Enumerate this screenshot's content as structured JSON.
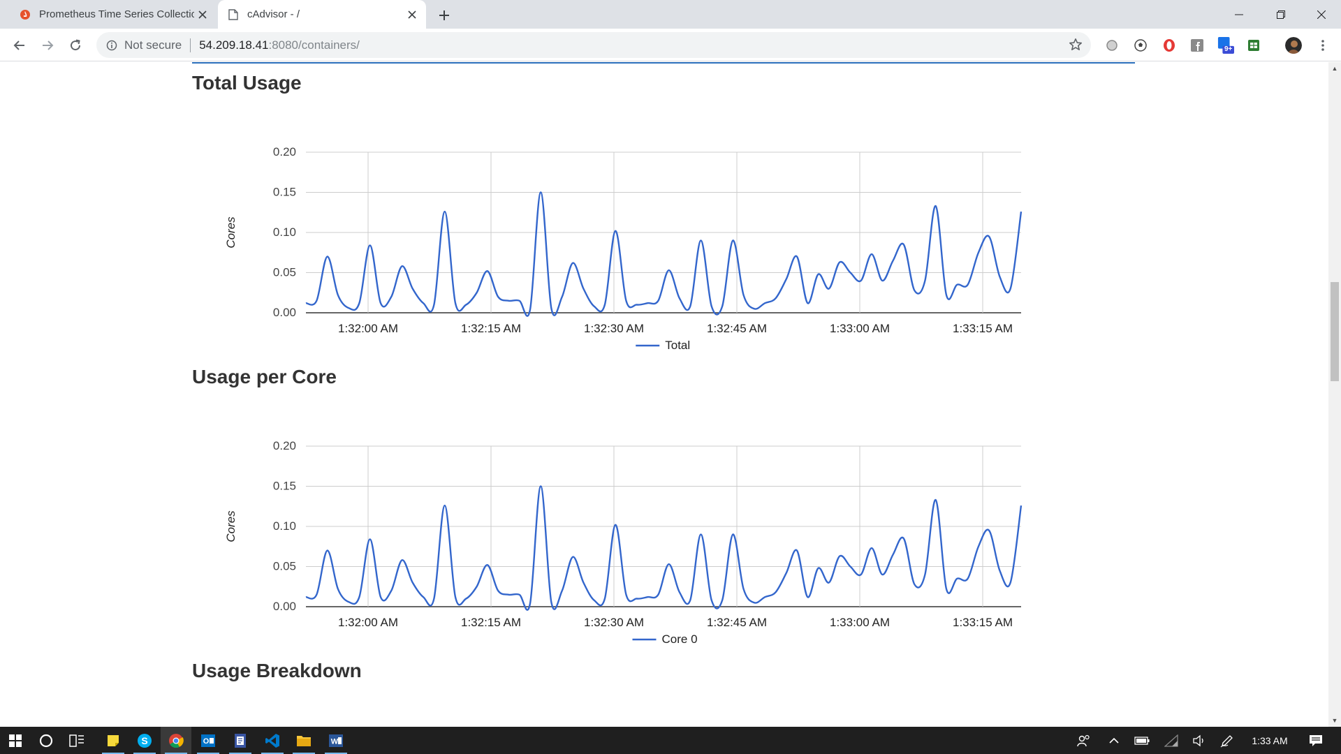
{
  "browser": {
    "tabs": [
      {
        "title": "Prometheus Time Series Collectio",
        "icon": "prometheus-icon",
        "active": false
      },
      {
        "title": "cAdvisor - /",
        "icon": "page-icon",
        "active": true
      }
    ],
    "omnibox": {
      "security_label": "Not secure",
      "url_host": "54.209.18.41",
      "url_path": ":8080/containers/"
    },
    "extensions": [
      {
        "name": "circle-extension-icon",
        "color": "#9e9e9e"
      },
      {
        "name": "soccer-extension-icon",
        "color": "#555555"
      },
      {
        "name": "opera-extension-icon",
        "color": "#e53935"
      },
      {
        "name": "facebook-extension-icon",
        "color": "#8a8a8a"
      },
      {
        "name": "notification-extension-icon",
        "color": "#1a73e8",
        "badge": "9+"
      },
      {
        "name": "sheet-extension-icon",
        "color": "#2e7d32"
      }
    ]
  },
  "page": {
    "sections": [
      {
        "heading": "Total Usage"
      },
      {
        "heading": "Usage per Core"
      },
      {
        "heading": "Usage Breakdown"
      }
    ]
  },
  "chart_data": [
    {
      "type": "line",
      "title": "Total Usage",
      "ylabel": "Cores",
      "xlabel": "",
      "ylim": [
        0,
        0.2
      ],
      "yticks": [
        "0.00",
        "0.05",
        "0.10",
        "0.15",
        "0.20"
      ],
      "xticks": [
        "1:32:00 AM",
        "1:32:15 AM",
        "1:32:30 AM",
        "1:32:45 AM",
        "1:33:00 AM",
        "1:33:15 AM"
      ],
      "x_start": "1:31:53 AM",
      "x_step_seconds": 1,
      "series": [
        {
          "name": "Total",
          "color": "#3366cc",
          "values": [
            0.012,
            0.015,
            0.07,
            0.022,
            0.006,
            0.012,
            0.084,
            0.012,
            0.02,
            0.058,
            0.03,
            0.012,
            0.01,
            0.126,
            0.012,
            0.01,
            0.025,
            0.052,
            0.02,
            0.015,
            0.015,
            0.004,
            0.15,
            0.005,
            0.02,
            0.062,
            0.03,
            0.008,
            0.01,
            0.102,
            0.015,
            0.01,
            0.012,
            0.015,
            0.053,
            0.018,
            0.008,
            0.09,
            0.008,
            0.008,
            0.09,
            0.022,
            0.005,
            0.012,
            0.018,
            0.042,
            0.07,
            0.012,
            0.048,
            0.03,
            0.063,
            0.05,
            0.04,
            0.073,
            0.04,
            0.065,
            0.085,
            0.028,
            0.04,
            0.133,
            0.022,
            0.035,
            0.035,
            0.075,
            0.095,
            0.045,
            0.03,
            0.126
          ]
        }
      ]
    },
    {
      "type": "line",
      "title": "Usage per Core",
      "ylabel": "Cores",
      "xlabel": "",
      "ylim": [
        0,
        0.2
      ],
      "yticks": [
        "0.00",
        "0.05",
        "0.10",
        "0.15",
        "0.20"
      ],
      "xticks": [
        "1:32:00 AM",
        "1:32:15 AM",
        "1:32:30 AM",
        "1:32:45 AM",
        "1:33:00 AM",
        "1:33:15 AM"
      ],
      "x_start": "1:31:53 AM",
      "x_step_seconds": 1,
      "series": [
        {
          "name": "Core 0",
          "color": "#3366cc",
          "values": [
            0.012,
            0.015,
            0.07,
            0.022,
            0.006,
            0.012,
            0.084,
            0.012,
            0.02,
            0.058,
            0.03,
            0.012,
            0.01,
            0.126,
            0.012,
            0.01,
            0.025,
            0.052,
            0.02,
            0.015,
            0.015,
            0.004,
            0.15,
            0.005,
            0.02,
            0.062,
            0.03,
            0.008,
            0.01,
            0.102,
            0.015,
            0.01,
            0.012,
            0.015,
            0.053,
            0.018,
            0.008,
            0.09,
            0.008,
            0.008,
            0.09,
            0.022,
            0.005,
            0.012,
            0.018,
            0.042,
            0.07,
            0.012,
            0.048,
            0.03,
            0.063,
            0.05,
            0.04,
            0.073,
            0.04,
            0.065,
            0.085,
            0.028,
            0.04,
            0.133,
            0.022,
            0.035,
            0.035,
            0.075,
            0.095,
            0.045,
            0.03,
            0.126
          ]
        }
      ]
    }
  ],
  "taskbar": {
    "clock": "1:33 AM",
    "apps": [
      {
        "name": "start-button",
        "running": false
      },
      {
        "name": "cortana-button",
        "running": false
      },
      {
        "name": "task-view-button",
        "running": false
      },
      {
        "name": "sticky-notes-app",
        "running": true
      },
      {
        "name": "skype-app",
        "running": true
      },
      {
        "name": "chrome-app",
        "running": true
      },
      {
        "name": "outlook-app",
        "running": true
      },
      {
        "name": "visio-app",
        "running": true
      },
      {
        "name": "vscode-app",
        "running": true
      },
      {
        "name": "file-explorer-app",
        "running": true
      },
      {
        "name": "word-app",
        "running": true
      }
    ]
  }
}
